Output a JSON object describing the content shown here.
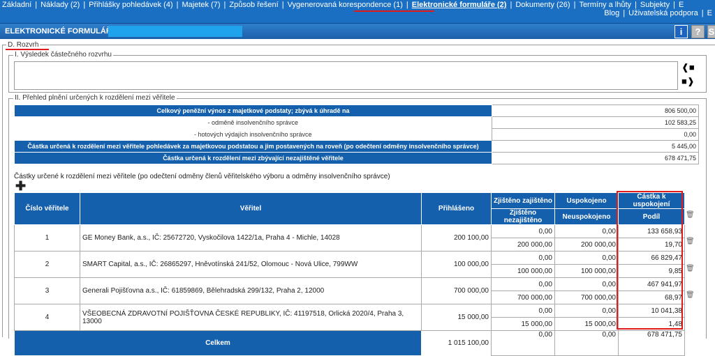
{
  "nav": {
    "items": [
      "Základní",
      "Náklady (2)",
      "Přihlášky pohledávek (4)",
      "Majetek (7)",
      "Způsob řešení",
      "Vygenerovaná korespondence (1)",
      "Elektronické formuláře (2)",
      "Dokumenty (26)",
      "Termíny a lhůty",
      "Subjekty"
    ],
    "active_index": 6,
    "blog": "Blog",
    "support": "Uživatelská podpora"
  },
  "title": "ELEKTRONICKÉ FORMULÁŘE -",
  "icons": {
    "info": "i",
    "help": "?",
    "logout": "S"
  },
  "section": {
    "legend": "D. Rozvrh",
    "part1_legend": "I. Výsledek částečného rozvrhu",
    "part2_legend": "II. Přehled plnění určených k rozdělení mezi věřitele"
  },
  "summary": [
    {
      "label": "Celkový peněžní výnos z majetkové podstaty; zbývá k úhradě na",
      "value": "806 500,00",
      "style": "blue"
    },
    {
      "label": "- odměně insolvenčního správce",
      "value": "102 583,25",
      "style": "plain"
    },
    {
      "label": "- hotových výdajích insolvenčního správce",
      "value": "0,00",
      "style": "plain"
    },
    {
      "label": "Částka určená k rozdělení mezi věřitele pohledávek za majetkovou podstatou a jim postavených na roveň (po odečtení odměny insolvenčního správce)",
      "value": "5 445,00",
      "style": "blue"
    },
    {
      "label": "Částka určená k rozdělení mezi zbývající nezajištěné věřitele",
      "value": "678 471,75",
      "style": "blue"
    }
  ],
  "caption2": "Částky určené k rozdělení mezi věřitele (po odečtení odměny členů věřitelského výboru a odměny insolvenčního správce)",
  "table": {
    "headers": {
      "cislo": "Číslo věřitele",
      "veritel": "Věřitel",
      "prihlaseno": "Přihlášeno",
      "zajisteni_top": "Zjištěno zajištěno",
      "zajisteni_bottom": "Zjištěno nezajištěno",
      "uspokojeno_top": "Uspokojeno",
      "uspokojeno_bottom": "Neuspokojeno",
      "castka_top": "Částka k uspokojení",
      "castka_bottom": "Podíl"
    },
    "rows": [
      {
        "no": "1",
        "name": "GE Money Bank, a.s., IČ: 25672720, Vyskočilova 1422/1a, Praha 4 - Michle, 14028",
        "prihlaseno": "200 100,00",
        "zaj": "0,00",
        "nezaj": "200 000,00",
        "usp": "0,00",
        "neusp": "200 000,00",
        "castka": "133 658,93",
        "podil": "19,70"
      },
      {
        "no": "2",
        "name": "SMART Capital, a.s., IČ: 26865297, Hněvotínská 241/52, Olomouc - Nová Ulice, 799WW",
        "prihlaseno": "100 000,00",
        "zaj": "0,00",
        "nezaj": "100 000,00",
        "usp": "0,00",
        "neusp": "100 000,00",
        "castka": "66 829,47",
        "podil": "9,85"
      },
      {
        "no": "3",
        "name": "Generali Pojišťovna a.s., IČ: 61859869, Bělehradská 299/132, Praha 2, 12000",
        "prihlaseno": "700 000,00",
        "zaj": "0,00",
        "nezaj": "700 000,00",
        "usp": "0,00",
        "neusp": "700 000,00",
        "castka": "467 941,97",
        "podil": "68,97"
      },
      {
        "no": "4",
        "name": "VŠEOBECNÁ ZDRAVOTNÍ POJIŠŤOVNA ČESKÉ REPUBLIKY, IČ: 41197518, Orlická 2020/4, Praha 3, 13000",
        "prihlaseno": "15 000,00",
        "zaj": "0,00",
        "nezaj": "15 000,00",
        "usp": "0,00",
        "neusp": "15 000,00",
        "castka": "10 041,38",
        "podil": "1,48"
      }
    ],
    "total": {
      "label": "Celkem",
      "prihlaseno": "1 015 100,00",
      "zaj": "0,00",
      "usp": "0,00",
      "castka": "678 471,75"
    }
  }
}
